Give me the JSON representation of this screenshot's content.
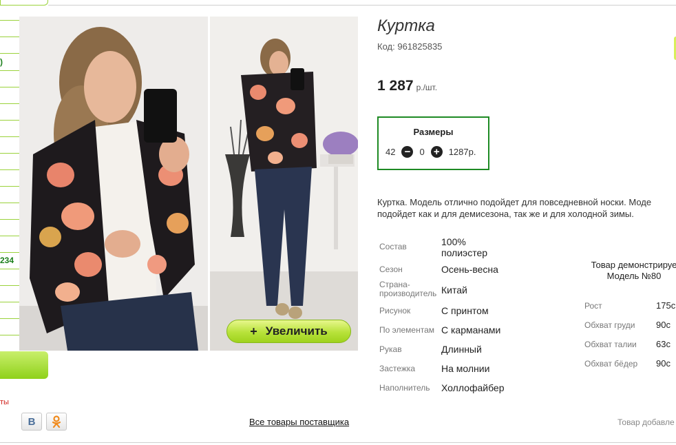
{
  "sidebar": {
    "items": [
      {
        "label": ")"
      },
      {
        "label": "234"
      }
    ],
    "footer_text": "ты",
    "social": {
      "vk_label": "В",
      "ok_label": "ок"
    }
  },
  "gallery": {
    "zoom_label": "Увеличить",
    "zoom_icon": "+"
  },
  "product": {
    "title": "Куртка",
    "code_label": "Код:",
    "code": "961825835",
    "price": "1 287",
    "price_unit": "р./шт.",
    "sizes": {
      "title": "Размеры",
      "size": "42",
      "quantity": "0",
      "row_price": "1287р."
    },
    "description_line1": "Куртка. Модель отлично подойдет для повседневной носки. Моде",
    "description_line2": "подойдет как и для демисезона, так же и для холодной зимы.",
    "specs": [
      {
        "key": "Состав",
        "value": "100% полиэстер"
      },
      {
        "key": "Сезон",
        "value": "Осень-весна"
      },
      {
        "key": "Страна-производитель",
        "value": "Китай"
      },
      {
        "key": "Рисунок",
        "value": "С принтом"
      },
      {
        "key": "По элементам",
        "value": "С карманами"
      },
      {
        "key": "Рукав",
        "value": "Длинный"
      },
      {
        "key": "Застежка",
        "value": "На молнии"
      },
      {
        "key": "Наполнитель",
        "value": "Холлофайбер"
      }
    ],
    "model": {
      "title_line1": "Товар демонстрируе",
      "title_line2": "Модель №80",
      "measurements": [
        {
          "key": "Рост",
          "value": "175с"
        },
        {
          "key": "Обхват груди",
          "value": "90с"
        },
        {
          "key": "Обхват талии",
          "value": "63с"
        },
        {
          "key": "Обхват бёдер",
          "value": "90с"
        }
      ]
    }
  },
  "footer": {
    "supplier_link": "Все товары поставщика",
    "added_text": "Товар добавле"
  },
  "colors": {
    "accent_green": "#1d8a23",
    "button_lime": "#b7e23a",
    "rail_line": "#9ad23a"
  }
}
